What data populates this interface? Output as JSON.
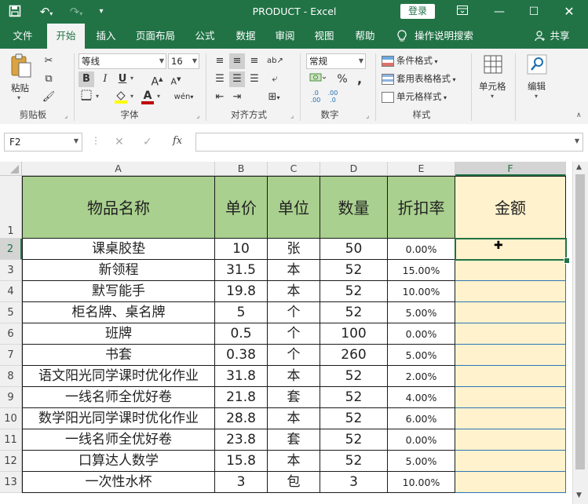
{
  "app": {
    "doc_title": "PRODUCT",
    "title_sep": "-",
    "app_name": "Excel",
    "login_label": "登录"
  },
  "tabs": [
    "文件",
    "开始",
    "插入",
    "页面布局",
    "公式",
    "数据",
    "审阅",
    "视图",
    "帮助"
  ],
  "tell_me": "操作说明搜索",
  "share": "共享",
  "ribbon": {
    "clipboard": {
      "paste": "粘贴",
      "label": "剪贴板"
    },
    "font": {
      "name": "等线",
      "size": "16",
      "label": "字体",
      "bold": "B",
      "italic": "I",
      "underline": "U",
      "grow": "A",
      "shrink": "A",
      "color_letter": "A",
      "fill_color": "#ffff00",
      "font_color": "#c00000",
      "phonetic": "wén"
    },
    "alignment": {
      "label": "对齐方式"
    },
    "number": {
      "format": "常规",
      "label": "数字",
      "percent": "%",
      "comma": ",",
      "inc": ".0\n.00",
      "dec": ".00\n.0"
    },
    "styles": {
      "cond": "条件格式",
      "table": "套用表格格式",
      "cell": "单元格样式",
      "label": "样式"
    },
    "cells": {
      "label": "单元格"
    },
    "edit": {
      "label": "编辑"
    }
  },
  "formula_bar": {
    "name_box": "F2",
    "fx": "fx",
    "value": ""
  },
  "columns": [
    "A",
    "B",
    "C",
    "D",
    "E",
    "F"
  ],
  "row_numbers": [
    "1",
    "2",
    "3",
    "4",
    "5",
    "6",
    "7",
    "8",
    "9",
    "10",
    "11",
    "12",
    "13"
  ],
  "table": {
    "headers": [
      "物品名称",
      "单价",
      "单位",
      "数量",
      "折扣率",
      "金额"
    ],
    "rows": [
      [
        "课桌胶垫",
        "10",
        "张",
        "50",
        "0.00%",
        ""
      ],
      [
        "新领程",
        "31.5",
        "本",
        "52",
        "15.00%",
        ""
      ],
      [
        "默写能手",
        "19.8",
        "本",
        "52",
        "10.00%",
        ""
      ],
      [
        "柜名牌、桌名牌",
        "5",
        "个",
        "52",
        "5.00%",
        ""
      ],
      [
        "班牌",
        "0.5",
        "个",
        "100",
        "0.00%",
        ""
      ],
      [
        "书套",
        "0.38",
        "个",
        "260",
        "5.00%",
        ""
      ],
      [
        "语文阳光同学课时优化作业",
        "31.8",
        "本",
        "52",
        "2.00%",
        ""
      ],
      [
        "一线名师全优好卷",
        "21.8",
        "套",
        "52",
        "4.00%",
        ""
      ],
      [
        "数学阳光同学课时优化作业",
        "28.8",
        "本",
        "52",
        "6.00%",
        ""
      ],
      [
        "一线名师全优好卷",
        "23.8",
        "套",
        "52",
        "0.00%",
        ""
      ],
      [
        "口算达人数学",
        "15.8",
        "本",
        "52",
        "5.00%",
        ""
      ],
      [
        "一次性水杯",
        "3",
        "包",
        "3",
        "10.00%",
        ""
      ]
    ]
  },
  "colors": {
    "brand": "#217346",
    "header_fill": "#a9d08e",
    "amount_fill": "#fff2cc",
    "selection": "#217346"
  },
  "selected_cell": "F2"
}
